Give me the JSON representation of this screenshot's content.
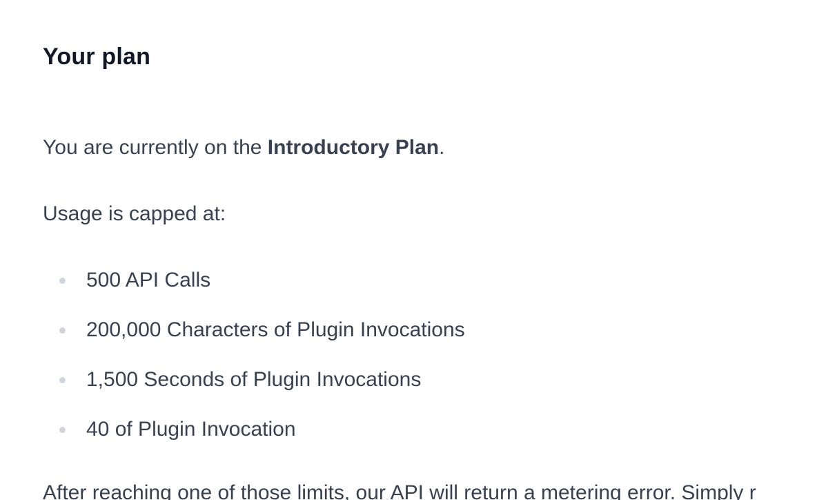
{
  "plan": {
    "title": "Your plan",
    "intro_prefix": "You are currently on the ",
    "plan_name": "Introductory Plan",
    "intro_suffix": ".",
    "cap_label": "Usage is capped at:",
    "limits": [
      "500 API Calls",
      "200,000 Characters of Plugin Invocations",
      "1,500 Seconds of Plugin Invocations",
      "40 of Plugin Invocation"
    ],
    "after_text": "After reaching one of those limits, our API will return a metering error. Simply r"
  }
}
